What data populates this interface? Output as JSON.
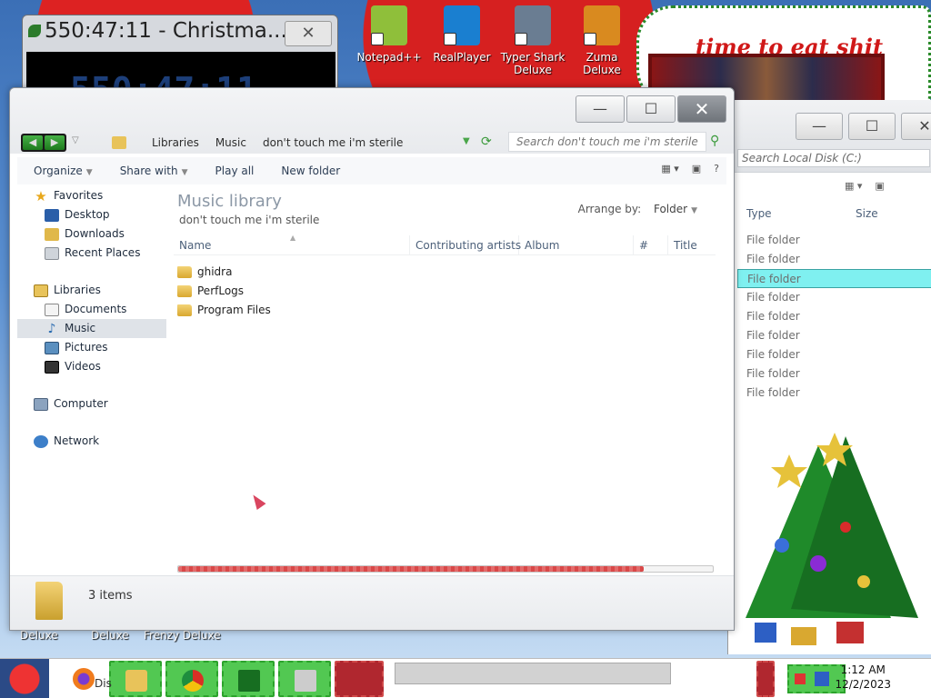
{
  "desktop": {
    "icons": [
      {
        "label": "Notepad++",
        "color": "#8fbf3a"
      },
      {
        "label": "RealPlayer",
        "color": "#1a7fd0"
      },
      {
        "label": "Typer Shark Deluxe",
        "color": "#6a7d92"
      },
      {
        "label": "Zuma Deluxe",
        "color": "#d98a1f"
      }
    ],
    "slogan": "time to eat shit",
    "bottom_labels": [
      "Deluxe",
      "Deluxe",
      "Frenzy Deluxe"
    ]
  },
  "timer_window": {
    "title": "550:47:11 - Christma...",
    "digits": "550:47:11",
    "close_glyph": "✕"
  },
  "bg_explorer": {
    "search_placeholder": "Search Local Disk (C:)",
    "col_type": "Type",
    "col_size": "Size",
    "rows": [
      "File folder",
      "File folder",
      "File folder",
      "File folder",
      "File folder",
      "File folder",
      "File folder",
      "File folder",
      "File folder"
    ],
    "selected_index": 2
  },
  "explorer": {
    "breadcrumbs": [
      "Libraries",
      "Music",
      "don't touch me i'm sterile"
    ],
    "search_placeholder": "Search don't touch me i'm sterile",
    "toolbar": {
      "organize": "Organize",
      "share_with": "Share with",
      "play_all": "Play all",
      "new_folder": "New folder"
    },
    "nav": {
      "favorites": "Favorites",
      "favorites_items": [
        "Desktop",
        "Downloads",
        "Recent Places"
      ],
      "libraries": "Libraries",
      "libraries_items": [
        "Documents",
        "Music",
        "Pictures",
        "Videos"
      ],
      "computer": "Computer",
      "network": "Network",
      "active": "Music"
    },
    "library_title": "Music library",
    "library_subtitle": "don't touch me i'm sterile",
    "arrange_label": "Arrange by:",
    "arrange_value": "Folder",
    "columns": [
      "Name",
      "Contributing artists",
      "Album",
      "#",
      "Title"
    ],
    "files": [
      "ghidra",
      "PerfLogs",
      "Program Files"
    ],
    "progress": 0.87,
    "item_count": "3 items"
  },
  "taskbar": {
    "clock_time": "1:12 AM",
    "clock_date": "12/2/2023",
    "task_label": "Dis"
  },
  "colors": {
    "accent_green": "#52c852",
    "selection_cyan": "#7ff0f0",
    "progress_red": "#d94848"
  }
}
